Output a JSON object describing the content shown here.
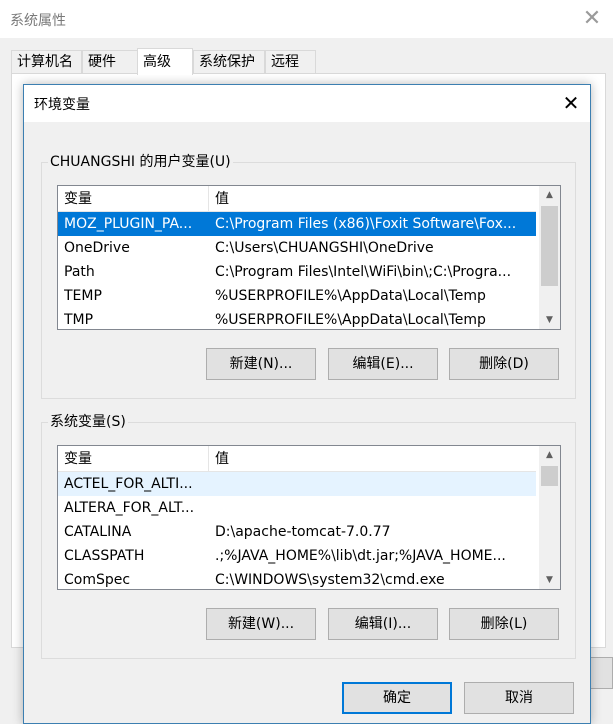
{
  "back_window": {
    "title": "系统属性",
    "close_glyph": "✕",
    "tabs": [
      {
        "label": "计算机名"
      },
      {
        "label": "硬件"
      },
      {
        "label": "高级"
      },
      {
        "label": "系统保护"
      },
      {
        "label": "远程"
      }
    ],
    "selected_tab": "高级"
  },
  "dialog": {
    "title": "环境变量",
    "close_glyph": "✕",
    "user_section": {
      "label": "CHUANGSHI 的用户变量(U)",
      "columns": {
        "name": "变量",
        "value": "值"
      },
      "rows": [
        {
          "name": "MOZ_PLUGIN_PA...",
          "value": "C:\\Program Files (x86)\\Foxit Software\\Fox..."
        },
        {
          "name": "OneDrive",
          "value": "C:\\Users\\CHUANGSHI\\OneDrive"
        },
        {
          "name": "Path",
          "value": "C:\\Program Files\\Intel\\WiFi\\bin\\;C:\\Progra..."
        },
        {
          "name": "TEMP",
          "value": "%USERPROFILE%\\AppData\\Local\\Temp"
        },
        {
          "name": "TMP",
          "value": "%USERPROFILE%\\AppData\\Local\\Temp"
        }
      ],
      "selected_row": 0,
      "buttons": {
        "new": "新建(N)...",
        "edit": "编辑(E)...",
        "delete": "删除(D)"
      }
    },
    "system_section": {
      "label": "系统变量(S)",
      "columns": {
        "name": "变量",
        "value": "值"
      },
      "rows": [
        {
          "name": "ACTEL_FOR_ALTI...",
          "value": ""
        },
        {
          "name": "ALTERA_FOR_ALT...",
          "value": ""
        },
        {
          "name": "CATALINA",
          "value": "D:\\apache-tomcat-7.0.77"
        },
        {
          "name": "CLASSPATH",
          "value": ".;%JAVA_HOME%\\lib\\dt.jar;%JAVA_HOME..."
        },
        {
          "name": "ComSpec",
          "value": "C:\\WINDOWS\\system32\\cmd.exe"
        }
      ],
      "hover_row": 0,
      "buttons": {
        "new": "新建(W)...",
        "edit": "编辑(I)...",
        "delete": "删除(L)"
      }
    },
    "ok_label": "确定",
    "cancel_label": "取消"
  },
  "icons": {
    "scroll_up": "▲",
    "scroll_down": "▼"
  },
  "colors": {
    "accent": "#0078d7",
    "selection_text": "#ffffff",
    "hover_row": "#e5f3ff",
    "button_face": "#e1e1e1"
  }
}
